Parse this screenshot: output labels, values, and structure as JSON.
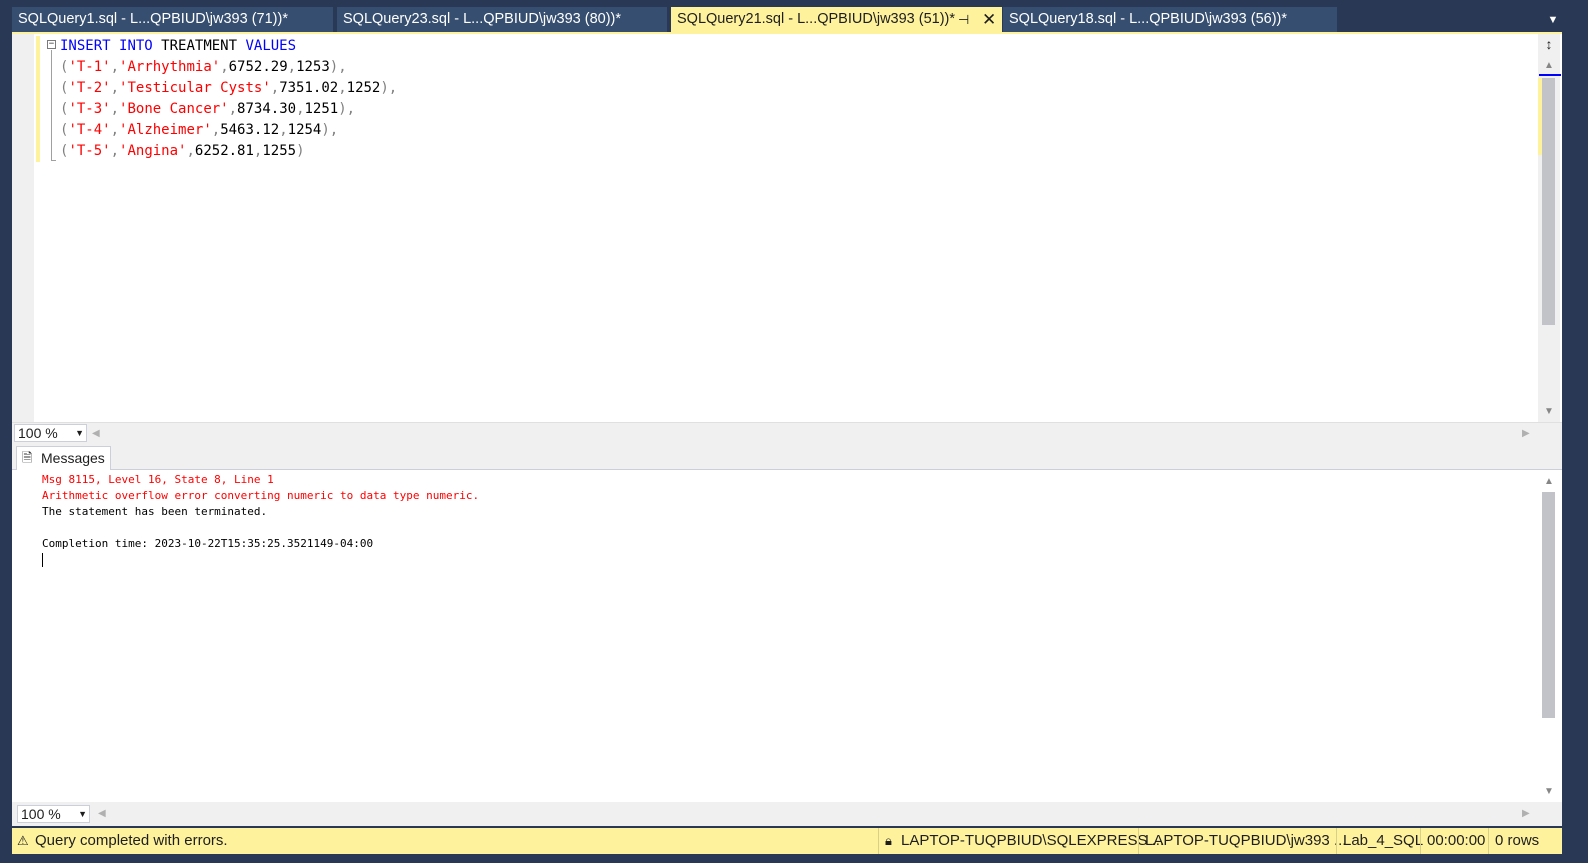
{
  "tabs": [
    {
      "title": "SQLQuery1.sql - L...QPBIUD\\jw393 (71))*",
      "active": false
    },
    {
      "title": "SQLQuery23.sql - L...QPBIUD\\jw393 (80))*",
      "active": false
    },
    {
      "title": "SQLQuery21.sql - L...QPBIUD\\jw393 (51))*",
      "active": true
    },
    {
      "title": "SQLQuery18.sql - L...QPBIUD\\jw393 (56))*",
      "active": false
    }
  ],
  "editor": {
    "line1": {
      "kw1": "INSERT",
      "kw2": "INTO",
      "table": "TREATMENT",
      "kw3": "VALUES"
    },
    "rows": [
      {
        "id": "'T-1'",
        "name": "'Arrhythmia'",
        "cost": "6752.29",
        "num": "1253",
        "end": "),"
      },
      {
        "id": "'T-2'",
        "name": "'Testicular Cysts'",
        "cost": "7351.02",
        "num": "1252",
        "end": "),"
      },
      {
        "id": "'T-3'",
        "name": "'Bone Cancer'",
        "cost": "8734.30",
        "num": "1251",
        "end": "),"
      },
      {
        "id": "'T-4'",
        "name": "'Alzheimer'",
        "cost": "5463.12",
        "num": "1254",
        "end": "),"
      },
      {
        "id": "'T-5'",
        "name": "'Angina'",
        "cost": "6252.81",
        "num": "1255",
        "end": ")"
      }
    ]
  },
  "zoom": {
    "editor": "100 %",
    "results": "100 %"
  },
  "results": {
    "tab_label": "Messages",
    "messages": {
      "error_line1": "Msg 8115, Level 16, State 8, Line 1",
      "error_line2": "Arithmetic overflow error converting numeric to data type numeric.",
      "info_line": "The statement has been terminated.",
      "completion": "Completion time: 2023-10-22T15:35:25.3521149-04:00"
    }
  },
  "status": {
    "message": "Query completed with errors.",
    "server": "LAPTOP-TUQPBIUD\\SQLEXPRESS ...",
    "user": "LAPTOP-TUQPBIUD\\jw393 ...",
    "database": "Lab_4_SQL",
    "elapsed": "00:00:00",
    "rows": "0 rows"
  },
  "colors": {
    "chrome": "#293955",
    "inactive_tab": "#364e6f",
    "active_tab": "#fff29d",
    "status_bar": "#fff29d",
    "keyword": "#0000ff",
    "string": "#ff0000",
    "error_text": "#ff0000"
  },
  "icons": [
    "pin-icon",
    "close-icon",
    "tab-overflow-icon",
    "split-icon",
    "messages-icon",
    "warning-icon",
    "lock-icon"
  ]
}
